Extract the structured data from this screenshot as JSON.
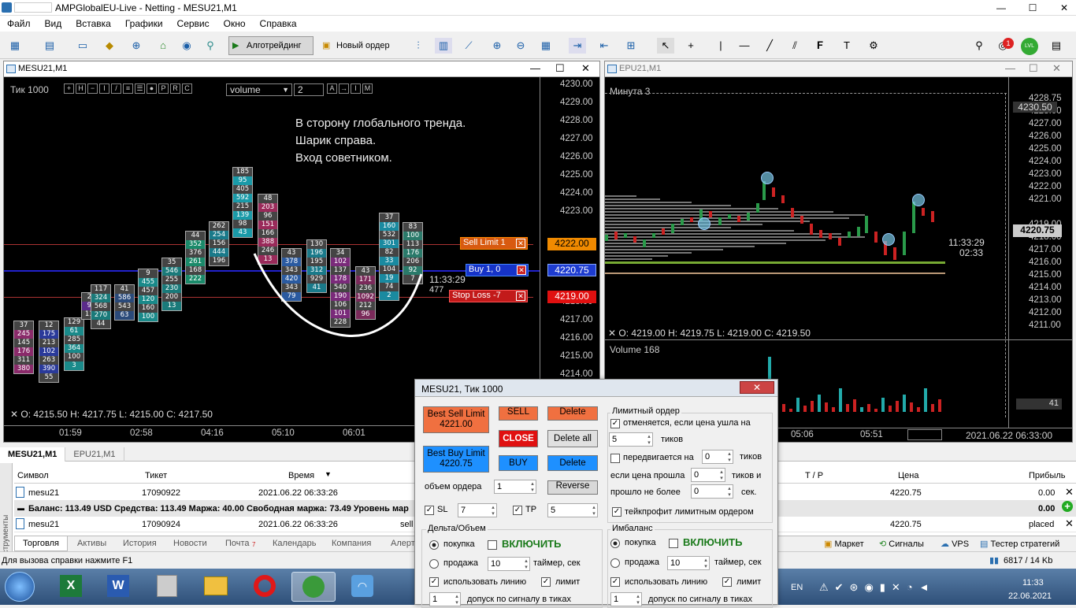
{
  "window": {
    "title": "AMPGlobalEU-Live - Netting - MESU21,M1"
  },
  "menu": [
    "Файл",
    "Вид",
    "Вставка",
    "Графики",
    "Сервис",
    "Окно",
    "Справка"
  ],
  "toolbar": {
    "algo": "Алготрейдинг",
    "new_order": "Новый ордер",
    "notif_badge": "1",
    "lvl": "LVL"
  },
  "chart1": {
    "title": "MESU21,M1",
    "tick_label": "Тик  1000",
    "indicator_select": "volume",
    "period_value": "2",
    "annotation": [
      "В сторону глобального тренда.",
      "Шарик справа.",
      "Вход советником."
    ],
    "ohlc": "O: 4215.50   H: 4217.75   L: 4215.00   C: 4217.50",
    "price_labels": [
      "4230.00",
      "4229.00",
      "4228.00",
      "4227.00",
      "4226.00",
      "4225.00",
      "4224.00",
      "4223.00",
      "4222.00",
      "4221.00",
      "4220.75",
      "4219.00",
      "4218.00",
      "4217.00",
      "4216.00",
      "4215.00",
      "4214.00"
    ],
    "time_labels": [
      "01:59",
      "02:58",
      "04:16",
      "05:10",
      "06:01"
    ],
    "sell_limit": "Sell Limit  1",
    "buy": "Buy  1,  0",
    "stop_loss": "Stop Loss   -7",
    "sell_limit_price": "4222.00",
    "buy_price": "4220.75",
    "stop_loss_price": "4219.00",
    "timer": "11:33:29",
    "timer_count": "477",
    "columns": [
      [
        "37",
        "245",
        "145",
        "176",
        "311",
        "380"
      ],
      [
        "12",
        "175",
        "213",
        "102",
        "263",
        "390",
        "55"
      ],
      [
        "129",
        "61",
        "285",
        "364",
        "100",
        "3"
      ],
      [
        "29",
        "90",
        "118"
      ],
      [
        "117",
        "324",
        "568",
        "270",
        "44"
      ],
      [
        "41",
        "586",
        "543",
        "63"
      ],
      [
        "9",
        "455",
        "457",
        "120",
        "160",
        "100"
      ],
      [
        "35",
        "546",
        "255",
        "230",
        "200",
        "13"
      ],
      [
        "44",
        "352",
        "376",
        "261",
        "168",
        "222"
      ],
      [
        "262",
        "254",
        "156",
        "444",
        "196"
      ],
      [
        "185",
        "95",
        "405",
        "592",
        "215",
        "139",
        "98",
        "43"
      ],
      [
        "48",
        "203",
        "96",
        "151",
        "166",
        "388",
        "246",
        "13"
      ],
      [
        "43",
        "378",
        "343",
        "420",
        "343",
        "79"
      ],
      [
        "130",
        "196",
        "195",
        "312",
        "929",
        "41"
      ],
      [
        "34",
        "102",
        "137",
        "178",
        "540",
        "190",
        "106",
        "101",
        "228"
      ],
      [
        "43",
        "171",
        "236",
        "1092",
        "212",
        "96"
      ],
      [
        "37",
        "160",
        "532",
        "301",
        "82",
        "33",
        "104",
        "19",
        "74",
        "2"
      ],
      [
        "83",
        "100",
        "113",
        "176",
        "206",
        "92",
        "7"
      ]
    ]
  },
  "chart2": {
    "title": "EPU21,M1",
    "label": "Минута  3",
    "ohlc": "O: 4219.00   H: 4219.75   L: 4219.00   C: 4219.50",
    "volume": "Volume 168",
    "volume_scale": "41",
    "price_labels": [
      "4230.50",
      "4229.00",
      "4228.75",
      "4228.00",
      "4227.00",
      "4226.00",
      "4225.00",
      "4224.00",
      "4223.00",
      "4222.00",
      "4221.00",
      "4220.75",
      "4219.00",
      "4218.00",
      "4217.00",
      "4216.00",
      "4215.00",
      "4214.00",
      "4213.00",
      "4212.00",
      "4211.00"
    ],
    "timer": "11:33:29",
    "timer2": "02:33",
    "time_labels": [
      "05:06",
      "05:51",
      "2021.06.22 06:33:00"
    ]
  },
  "terminal": {
    "tabs": [
      "MESU21,M1",
      "EPU21,M1"
    ],
    "headers": {
      "symbol": "Символ",
      "ticket": "Тикет",
      "time": "Время",
      "tp": "T / P",
      "price": "Цена",
      "profit": "Прибыль"
    },
    "rows": [
      {
        "symbol": "mesu21",
        "ticket": "17090922",
        "time": "2021.06.22 06:33:26",
        "price": "4220.75",
        "profit": "0.00"
      },
      {
        "symbol": "mesu21",
        "ticket": "17090924",
        "time": "2021.06.22 06:33:26",
        "type": "sell",
        "price": "4220.75",
        "profit": "placed"
      }
    ],
    "balance": "Баланс: 113.49 USD  Средства: 113.49  Маржа: 40.00  Свободная маржа: 73.49  Уровень мар",
    "balance_profit": "0.00",
    "bottom_tabs": [
      "Торговля",
      "Активы",
      "История",
      "Новости",
      "Почта",
      "Календарь",
      "Компания",
      "Алерт"
    ],
    "mail_count": "7",
    "right_tabs": [
      "Маркет",
      "Сигналы",
      "VPS",
      "Тестер стратегий"
    ],
    "side_label": "Инструменты"
  },
  "status": {
    "help": "Для вызова справки нажмите F1",
    "traffic": "6817 / 14 Kb"
  },
  "dialog": {
    "title": "MESU21, Тик  1000",
    "best_sell": "Best Sell Limit",
    "best_sell_price": "4221.00",
    "best_buy": "Best Buy Limit",
    "best_buy_price": "4220.75",
    "sell": "SELL",
    "close": "CLOSE",
    "buy": "BUY",
    "delete": "Delete",
    "delete_all": "Delete all",
    "reverse": "Reverse",
    "volume_label": "объем ордера",
    "volume": "1",
    "sl_label": "SL",
    "sl": "7",
    "tp_label": "TP",
    "tp": "5",
    "limit_group": "Лимитный ордер",
    "cancel_label": "отменяется, если цена ушла на",
    "cancel_ticks": "5",
    "ticks": "тиков",
    "move_label": "передвигается на",
    "move_ticks": "0",
    "ticks2": "тиков",
    "if_went": "если цена прошла",
    "if_went_val": "0",
    "ticks_and": "тиков и",
    "not_more": "прошло не более",
    "not_more_val": "0",
    "sec": "сек.",
    "tp_limit": "тейкпрофит лимитным ордером",
    "delta_group": "Дельта/Объем",
    "imb_group": "Имбаланс",
    "buy_radio": "покупка",
    "sell_radio": "продажа",
    "enable": "ВКЛЮЧИТЬ",
    "timer_val": "10",
    "timer_label": "таймер, сек",
    "use_line": "использовать линию",
    "limit": "лимит",
    "tol_val": "1",
    "tol_label": "допуск по сигналу в тиках",
    "imb_buy": "покупка",
    "imb_sell": "продажа",
    "imb_enable": "ВКЛЮЧИТЬ",
    "imb_timer": "10",
    "imb_timer_label": "таймер, сек",
    "imb_use_line": "использовать линию",
    "imb_limit": "лимит",
    "imb_tol": "1",
    "imb_tol_label": "допуск по сигналу в тиках"
  },
  "taskbar": {
    "lang": "EN",
    "time": "11:33",
    "date": "22.06.2021"
  }
}
